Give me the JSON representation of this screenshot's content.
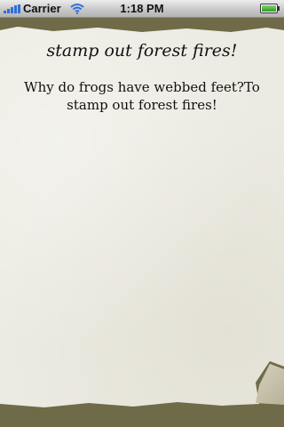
{
  "status_bar": {
    "carrier": "Carrier",
    "time": "1:18 PM",
    "signal_icon": "signal-bars-icon",
    "wifi_icon": "wifi-icon",
    "battery_icon": "battery-icon"
  },
  "joke": {
    "title": "stamp out forest fires!",
    "body": "Why do frogs have webbed feet?To stamp out forest fires!"
  }
}
